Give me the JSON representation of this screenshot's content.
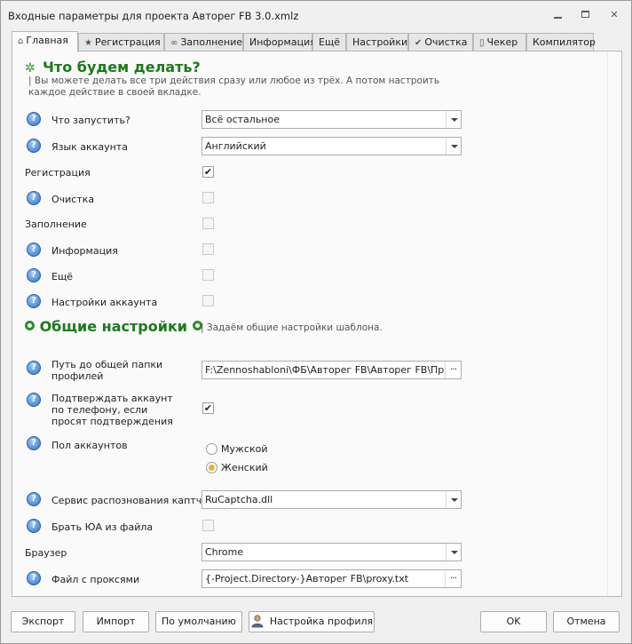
{
  "window": {
    "title": "Входные параметры для проекта Авторег FB 3.0.xmlz"
  },
  "tabs": [
    {
      "label": "Главная",
      "icon": "home-icon",
      "glyph": "⌂"
    },
    {
      "label": "Регистрация",
      "icon": "star-icon",
      "glyph": "★"
    },
    {
      "label": "Заполнение",
      "icon": "infinity-icon",
      "glyph": "∞"
    },
    {
      "label": "Информация",
      "icon": "",
      "glyph": ""
    },
    {
      "label": "Ещё",
      "icon": "",
      "glyph": ""
    },
    {
      "label": "Настройки",
      "icon": "",
      "glyph": ""
    },
    {
      "label": "Очистка",
      "icon": "check-icon",
      "glyph": "✔"
    },
    {
      "label": "Чекер",
      "icon": "phone-icon",
      "glyph": "▯"
    },
    {
      "label": "Компилятор",
      "icon": "",
      "glyph": ""
    }
  ],
  "main": {
    "heading": "Что будем делать?",
    "description": "| Вы можете делать все три действия сразу или любое из трёх. А потом настроить каждое действие в своей вкладке.",
    "run_label": "Что запустить?",
    "run_value": "Всё остальное",
    "language_label": "Язык аккаунта",
    "language_value": "Английский",
    "registration_label": "Регистрация",
    "registration_checked": true,
    "cleanup_label": "Очистка",
    "filling_label": "Заполнение",
    "information_label": "Информация",
    "more_label": "Ещё",
    "account_settings_label": "Настройки аккаунта"
  },
  "general": {
    "heading": "Общие настройки",
    "description": "| Задаём общие настройки шаблона.",
    "profiles_path_label": "Путь до общей папки профилей",
    "profiles_path_value": "F:\\Zennoshabloni\\ФБ\\Авторег FB\\Авторег FB\\Профили",
    "confirm_phone_label": "Подтверждать аккаунт по телефону, если просят подтверждения",
    "confirm_phone_checked": true,
    "gender_label": "Пол аккаунтов",
    "gender_male": "Мужской",
    "gender_female": "Женский",
    "gender_selected": "Женский",
    "captcha_label": "Сервис распознования каптчи",
    "captcha_value": "RuCaptcha.dll",
    "ua_label": "Брать ЮА из файла",
    "browser_label": "Браузер",
    "browser_value": "Chrome",
    "proxy_label": "Файл с проксями",
    "proxy_value": "{-Project.Directory-}Авторег FB\\proxy.txt"
  },
  "footer": {
    "export": "Экспорт",
    "import": "Импорт",
    "defaults": "По умолчанию",
    "profile_settings": "Настройка профиля",
    "ok": "OK",
    "cancel": "Отмена"
  }
}
